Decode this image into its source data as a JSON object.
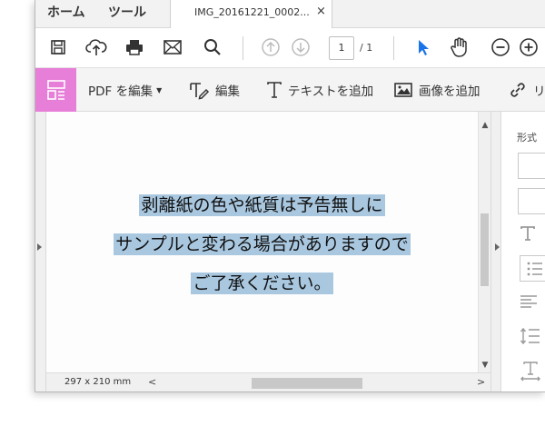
{
  "tabs": {
    "home": "ホーム",
    "tools": "ツール",
    "document": "IMG_20161221_0002...",
    "close": "×"
  },
  "toolbar": {
    "icons": [
      "save-icon",
      "upload-icon",
      "print-icon",
      "mail-icon",
      "search-icon",
      "page-up-icon",
      "page-down-icon",
      "select-arrow-icon",
      "hand-icon",
      "zoom-out-icon",
      "zoom-in-icon"
    ],
    "page_current": "1",
    "page_total": "/ 1"
  },
  "editbar": {
    "edit_pdf": "PDF を編集",
    "edit": "編集",
    "add_text": "テキストを追加",
    "add_image": "画像を追加",
    "link": "リ"
  },
  "document": {
    "lines": [
      "剥離紙の色や紙質は予告無しに",
      "サンプルと変わる場合がありますので",
      "ご了承ください。"
    ],
    "highlight_color": "#a9c8e0"
  },
  "status": {
    "page_size": "297 x 210 mm",
    "scroll_left": "<",
    "scroll_right": ">"
  },
  "format_panel": {
    "title": "形式"
  },
  "colors": {
    "edit_mode_accent": "#e77fd8",
    "select_tool_blue": "#1a73e8"
  }
}
